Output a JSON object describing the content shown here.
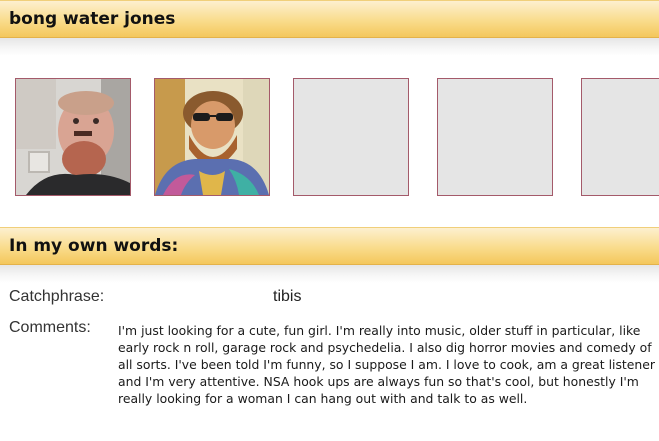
{
  "header": {
    "title": "bong water jones"
  },
  "photos": {
    "slots": [
      {
        "icon": "profile-photo-1",
        "filled": true
      },
      {
        "icon": "profile-photo-2",
        "filled": true
      },
      {
        "icon": "empty-photo-slot",
        "filled": false
      },
      {
        "icon": "empty-photo-slot",
        "filled": false
      },
      {
        "icon": "empty-photo-slot",
        "filled": false
      }
    ]
  },
  "about": {
    "title": "In my own words:",
    "catchphrase_label": "Catchphrase:",
    "catchphrase_value": "tibis",
    "comments_label": "Comments:",
    "comments_text": "I'm just looking for a cute, fun girl. I'm really into music, older stuff in particular, like early rock n roll, garage rock and psychedelia. I also dig horror movies and comedy of all sorts. I've been told I'm funny, so I suppose I am. I love to cook, am a great listener and I'm very attentive. NSA hook ups are always fun so that's cool, but honestly I'm really looking for a woman I can hang out with and talk to as well."
  },
  "colors": {
    "header_gradient_top": "#fdf0cf",
    "header_gradient_bottom": "#f4c75c",
    "photo_border": "#a45a6a",
    "empty_slot": "#e5e5e5"
  }
}
